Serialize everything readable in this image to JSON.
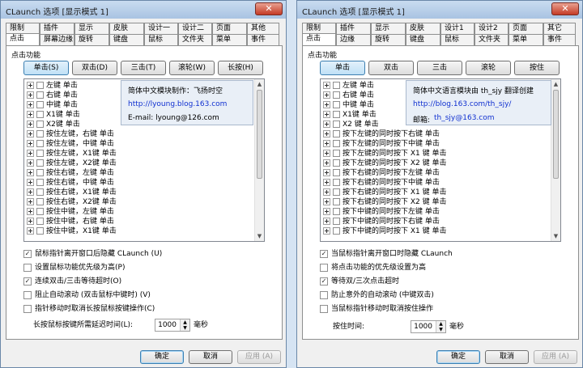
{
  "left": {
    "title": "CLaunch 选项 [显示模式 1]",
    "close": "✕",
    "tabs_row1": [
      "限制",
      "插件",
      "显示",
      "皮肤",
      "设计一",
      "设计二",
      "页面",
      "其他"
    ],
    "tabs_row2": [
      "点击",
      "屏幕边缘",
      "旋转",
      "键盘",
      "鼠标",
      "文件夹",
      "菜单",
      "事件"
    ],
    "group": "点击功能",
    "func_buttons": [
      "单击(S)",
      "双击(D)",
      "三击(T)",
      "滚轮(W)",
      "长按(H)"
    ],
    "tree_items": [
      "左键 单击",
      "右键 单击",
      "中键 单击",
      "X1键 单击",
      "X2键 单击",
      "按住左键，右键 单击",
      "按住左键，中键 单击",
      "按住左键，X1键 单击",
      "按住左键，X2键 单击",
      "按住右键，左键 单击",
      "按住右键，中键 单击",
      "按住右键，X1键 单击",
      "按住右键，X2键 单击",
      "按住中键，左键 单击",
      "按住中键，右键 单击",
      "按住中键，X1键 单击"
    ],
    "tooltip": {
      "line1": "简体中文模块制作：飞扬时空",
      "line2": "http://lyoung.blog.163.com",
      "line3": "E-mail: lyoung@126.com"
    },
    "options": [
      {
        "label": "鼠标指针离开窗口后隐藏 CLaunch (U)",
        "checked": "✓"
      },
      {
        "label": "设置鼠标功能优先级为高(P)",
        "checked": ""
      },
      {
        "label": "连续双击/三击等待超时(O)",
        "checked": "✓"
      },
      {
        "label": "阻止自动滚动 (双击鼠标中键时) (V)",
        "checked": ""
      },
      {
        "label": "指针移动时取消长按鼠标按键操作(C)",
        "checked": ""
      }
    ],
    "delay_label": "长按鼠标按键所需延迟时间(L):",
    "delay_value": "1000",
    "delay_unit": "毫秒",
    "ok": "确定",
    "cancel": "取消",
    "apply": "应用 (A)"
  },
  "right": {
    "title": "CLaunch 选项 [显示模式 1]",
    "close": "✕",
    "tabs_row1": [
      "限制",
      "插件",
      "显示",
      "皮肤",
      "设计1",
      "设计2",
      "页面",
      "其它"
    ],
    "tabs_row2": [
      "点击",
      "边缘",
      "旋转",
      "键盘",
      "鼠标",
      "文件夹",
      "菜单",
      "事件"
    ],
    "group": "点击功能",
    "func_buttons": [
      "单击",
      "双击",
      "三击",
      "滚轮",
      "按住"
    ],
    "tree_items": [
      "左键 单击",
      "右键 单击",
      "中键 单击",
      "X1键 单击",
      "X2 键 单击",
      "按下左键的同时按下右键 单击",
      "按下左键的同时按下中键 单击",
      "按下左键的同时按下 X1 键 单击",
      "按下左键的同时按下 X2 键 单击",
      "按下右键的同时按下左键 单击",
      "按下右键的同时按下中键 单击",
      "按下右键的同时按下 X1 键 单击",
      "按下右键的同时按下 X2 键 单击",
      "按下中键的同时按下左键 单击",
      "按下中键的同时按下右键 单击",
      "按下中键的同时按下 X1 键 单击"
    ],
    "tooltip": {
      "line1": "简体中文语言模块由 th_sjy 翻译创建",
      "line2": "http://blog.163.com/th_sjy/",
      "line3_label": "邮箱:",
      "line3_link": "th_sjy@163.com"
    },
    "options": [
      {
        "label": "当鼠标指针离开窗口时隐藏 CLaunch",
        "checked": "✓"
      },
      {
        "label": "将点击功能的优先级设置为高",
        "checked": ""
      },
      {
        "label": "等待双/三次点击超时",
        "checked": "✓"
      },
      {
        "label": "防止意外的自动滚动 (中键双击)",
        "checked": ""
      },
      {
        "label": "当鼠标指针移动时取消按住操作",
        "checked": ""
      }
    ],
    "delay_label": "按住时间:",
    "delay_value": "1000",
    "delay_unit": "毫秒",
    "ok": "确定",
    "cancel": "取消",
    "apply": "应用 (A)"
  }
}
